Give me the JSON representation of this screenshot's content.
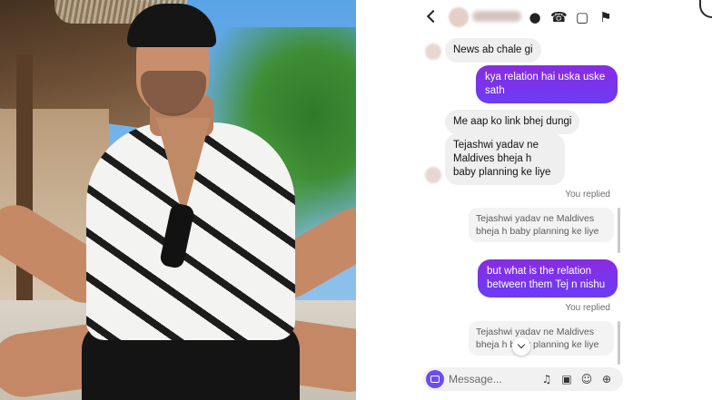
{
  "chat": {
    "header": {
      "back_icon": "chevron-left-icon",
      "icons": [
        "sticker-icon",
        "phone-icon",
        "video-icon",
        "flag-icon"
      ]
    },
    "messages": [
      {
        "from": "them",
        "text": "News ab chale gi"
      },
      {
        "from": "me",
        "text": "kya relation hai uska uske sath"
      },
      {
        "from": "them",
        "text": "Me aap ko link bhej dungi"
      },
      {
        "from": "them",
        "text": "Tejashwi yadav ne Maldives bheja h baby planning ke liye"
      }
    ],
    "replies": [
      {
        "label": "You replied",
        "quoted": "Tejashwi yadav ne Maldives bheja h baby planning ke liye",
        "text": "but what is the relation between them Tej n nishu"
      },
      {
        "label": "You replied",
        "quoted": "Tejashwi yadav ne Maldives bheja h baby planning ke liye"
      }
    ],
    "composer": {
      "placeholder": "Message...",
      "icons": [
        "camera-icon",
        "microphone-icon",
        "gallery-icon",
        "sticker-icon",
        "plus-icon"
      ]
    },
    "accent_color": "#7d2ff0"
  }
}
